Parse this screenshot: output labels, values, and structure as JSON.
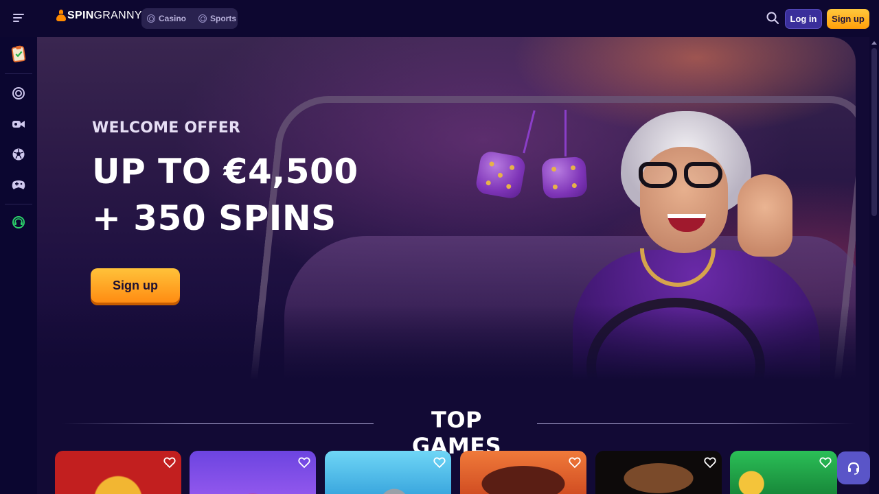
{
  "header": {
    "logo_bold": "SPIN",
    "logo_light": "GRANNY",
    "nav": [
      {
        "label": "Casino",
        "icon": "casino-chip-icon"
      },
      {
        "label": "Sports",
        "icon": "soccer-ball-icon"
      }
    ],
    "login_label": "Log in",
    "signup_label": "Sign up"
  },
  "sidebar": {
    "items": [
      {
        "icon": "promotions-clipboard-icon"
      },
      {
        "icon": "casino-chip-icon"
      },
      {
        "icon": "live-camera-icon"
      },
      {
        "icon": "soccer-ball-icon"
      },
      {
        "icon": "gamepad-icon"
      },
      {
        "icon": "support-headset-icon"
      }
    ]
  },
  "hero": {
    "eyebrow": "WELCOME OFFER",
    "title_line1": "UP TO €4,500",
    "title_line2": "+ 350 SPINS",
    "cta_label": "Sign up"
  },
  "top_games": {
    "title": "TOP GAMES",
    "cards": [
      {
        "name": "game-1",
        "colors": [
          "#c21f1f",
          "#f2b632"
        ]
      },
      {
        "name": "game-2",
        "colors": [
          "#7a4de6",
          "#e8334a"
        ]
      },
      {
        "name": "game-3",
        "colors": [
          "#3bb6e8",
          "#1e7fbf"
        ]
      },
      {
        "name": "game-4",
        "colors": [
          "#e0562a",
          "#5a1e14"
        ]
      },
      {
        "name": "game-5",
        "colors": [
          "#111111",
          "#3a2a1a"
        ]
      },
      {
        "name": "game-6",
        "colors": [
          "#1f9c3c",
          "#f4c43a"
        ]
      }
    ]
  },
  "colors": {
    "accent_orange": "#ff9f0a",
    "login_purple": "#3a2f9b",
    "background": "#120a35",
    "support_button": "#5a55c8"
  }
}
